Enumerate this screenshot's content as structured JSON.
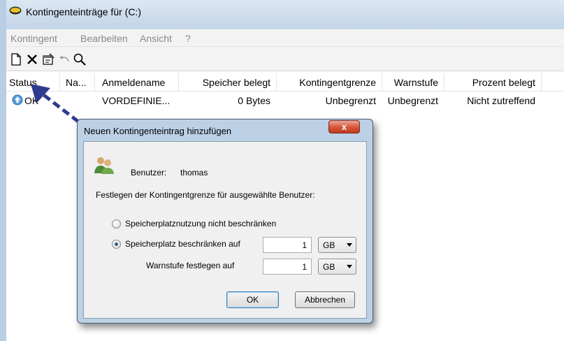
{
  "window": {
    "title": "Kontingenteinträge für  (C:)"
  },
  "menu": [
    "Kontingent",
    "Bearbeiten",
    "Ansicht",
    "?"
  ],
  "toolbar": {
    "icons": [
      "new-entry-icon",
      "delete-icon",
      "properties-icon",
      "undo-icon",
      "find-icon"
    ]
  },
  "table": {
    "columns": [
      "Status",
      "Na...",
      "Anmeldename",
      "Speicher belegt",
      "Kontingentgrenze",
      "Warnstufe",
      "Prozent belegt"
    ],
    "rows": [
      {
        "status": "OK",
        "name": "",
        "login": "VORDEFINIE...",
        "used": "0 Bytes",
        "limit": "Unbegrenzt",
        "warning": "Unbegrenzt",
        "percent": "Nicht zutreffend"
      }
    ]
  },
  "dialog": {
    "title": "Neuen Kontingenteintrag hinzufügen",
    "close_label": "x",
    "user_label": "Benutzer:",
    "user_value": "thomas",
    "instruction": "Festlegen der Kontingentgrenze für ausgewählte Benutzer:",
    "option_unlimited": "Speicherplatznutzung nicht beschränken",
    "option_limited": "Speicherplatz beschränken auf",
    "limit_value": "1",
    "limit_unit": "GB",
    "warning_label": "Warnstufe festlegen auf",
    "warning_value": "1",
    "warning_unit": "GB",
    "ok_label": "OK",
    "cancel_label": "Abbrechen",
    "selected_option": "limited"
  },
  "colors": {
    "accent": "#2f3b8f",
    "title_bar": "#cfdded",
    "close_button": "#d9573c"
  }
}
